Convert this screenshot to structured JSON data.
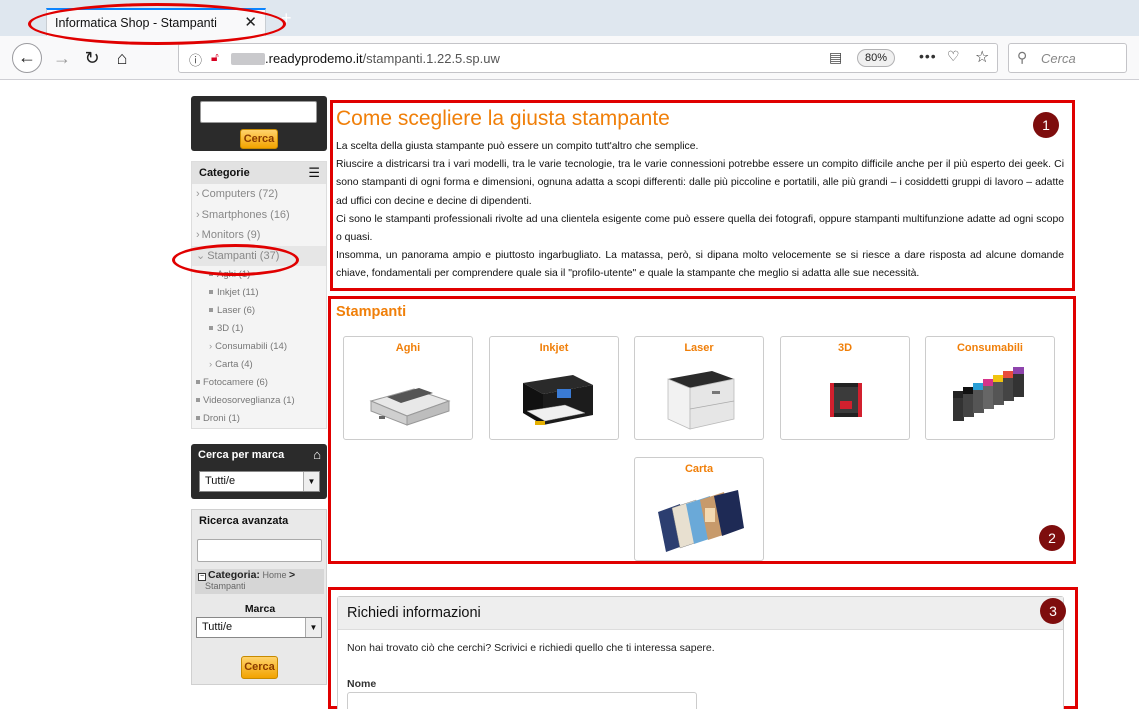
{
  "browser": {
    "tab_title": "Informatica Shop - Stampanti",
    "url_host": ".readyprodemo.it",
    "url_path": "/stampanti.1.22.5.sp.uw",
    "zoom": "80%",
    "search_placeholder": "Cerca"
  },
  "sidebar": {
    "search_button": "Cerca",
    "categories_title": "Categorie",
    "categories": [
      {
        "label": "Computers (72)"
      },
      {
        "label": "Smartphones (16)"
      },
      {
        "label": "Monitors (9)"
      },
      {
        "label": "Stampanti (37)"
      }
    ],
    "subcategories": [
      {
        "label": "Aghi (1)"
      },
      {
        "label": "Inkjet (11)"
      },
      {
        "label": "Laser (6)"
      },
      {
        "label": "3D (1)"
      },
      {
        "label": "Consumabili (14)"
      },
      {
        "label": "Carta (4)"
      }
    ],
    "other_categories": [
      {
        "label": "Fotocamere (6)"
      },
      {
        "label": "Videosorveglianza (1)"
      },
      {
        "label": "Droni (1)"
      }
    ],
    "brand_title": "Cerca per marca",
    "brand_select": "Tutti/e",
    "advanced_title": "Ricerca avanzata",
    "advanced_category_label": "Categoria:",
    "advanced_category_path_home": "Home",
    "advanced_category_path_sep": ">",
    "advanced_category_path_cur": "Stampanti",
    "advanced_brand_label": "Marca",
    "advanced_brand_select": "Tutti/e",
    "advanced_button": "Cerca"
  },
  "intro": {
    "title": "Come scegliere la giusta stampante",
    "paragraphs": [
      "La scelta della giusta stampante può essere un compito tutt'altro che semplice.",
      "Riuscire a districarsi tra i vari modelli, tra le varie tecnologie, tra le varie connessioni potrebbe essere un compito difficile anche per il più esperto dei geek. Ci sono stampanti di ogni forma e dimensioni, ognuna adatta a scopi differenti: dalle più piccoline e portatili, alle più grandi – i cosiddetti gruppi di lavoro – adatte ad uffici con decine e decine di dipendenti.",
      "Ci sono le stampanti professionali rivolte ad una clientela esigente come può essere quella dei fotografi, oppure stampanti multifunzione adatte ad ogni scopo o quasi.",
      "Insomma, un panorama ampio e piuttosto ingarbugliato. La matassa, però, si dipana molto velocemente se si riesce a dare risposta ad alcune domande chiave, fondamentali per comprendere quale sia il \"profilo-utente\" e quale la stampante che meglio si adatta alle sue necessità."
    ]
  },
  "stampanti": {
    "title": "Stampanti",
    "cards": [
      {
        "label": "Aghi",
        "icon": "dot-matrix-printer-image"
      },
      {
        "label": "Inkjet",
        "icon": "inkjet-printer-image"
      },
      {
        "label": "Laser",
        "icon": "laser-printer-image"
      },
      {
        "label": "3D",
        "icon": "3d-printer-image"
      },
      {
        "label": "Consumabili",
        "icon": "ink-cartridges-image"
      },
      {
        "label": "Carta",
        "icon": "photo-paper-image"
      }
    ]
  },
  "info": {
    "title": "Richiedi informazioni",
    "subtitle": "Non hai trovato ciò che cerchi? Scrivici e richiedi quello che ti interessa sapere.",
    "name_label": "Nome"
  },
  "annotations": {
    "badge1": "1",
    "badge2": "2",
    "badge3": "3",
    "color": "#e00000"
  }
}
